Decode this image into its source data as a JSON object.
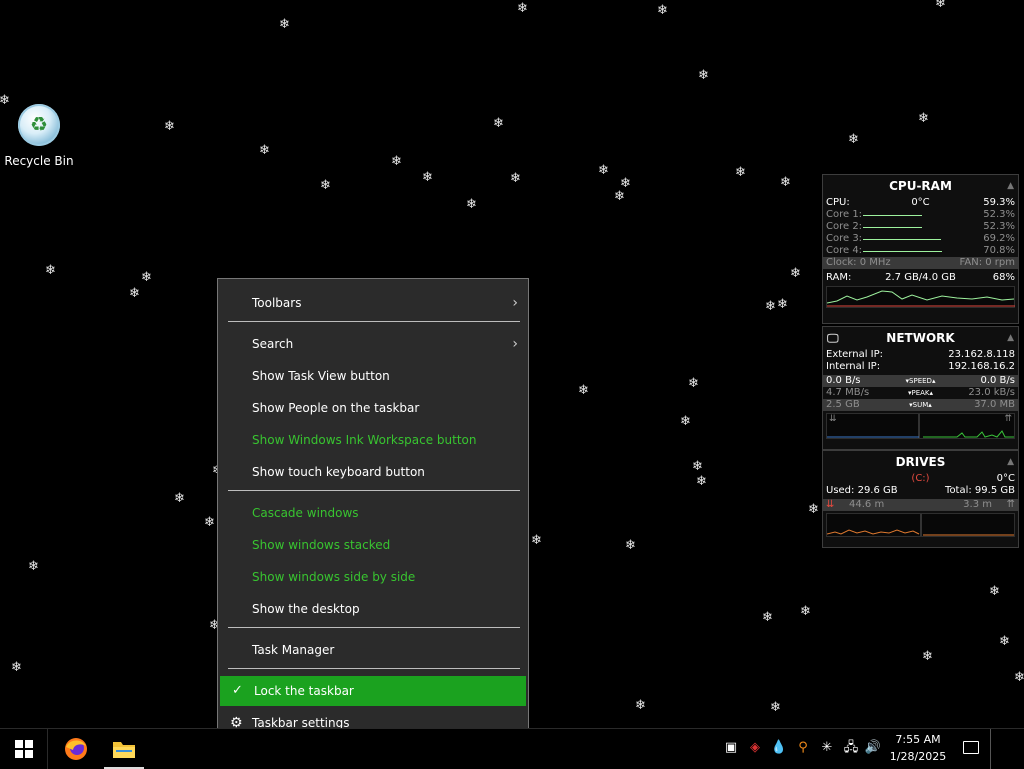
{
  "desktop": {
    "recycle_bin_label": "Recycle Bin"
  },
  "context_menu": {
    "toolbars": "Toolbars",
    "search": "Search",
    "show_task_view": "Show Task View button",
    "show_people": "Show People on the taskbar",
    "show_ink": "Show Windows Ink Workspace button",
    "show_touch_keyboard": "Show touch keyboard button",
    "cascade": "Cascade windows",
    "stacked": "Show windows stacked",
    "side_by_side": "Show windows side by side",
    "show_desktop": "Show the desktop",
    "task_manager": "Task Manager",
    "lock_taskbar": "Lock the taskbar",
    "taskbar_settings": "Taskbar settings",
    "chevron": "›",
    "check": "✓",
    "gear": "⚙",
    "highlight_color": "#1ba21f",
    "disabled_color": "#38c430"
  },
  "cpu_ram": {
    "title": "CPU-RAM",
    "cpu_label": "CPU:",
    "cpu_temp": "0°C",
    "cpu_pct": "59.3%",
    "cores": [
      {
        "label": "Core 1:",
        "value": "52.3%",
        "load": 0.523
      },
      {
        "label": "Core 2:",
        "value": "52.3%",
        "load": 0.523
      },
      {
        "label": "Core 3:",
        "value": "69.2%",
        "load": 0.692
      },
      {
        "label": "Core 4:",
        "value": "70.8%",
        "load": 0.708
      }
    ],
    "clock": "Clock: 0 MHz",
    "fan": "FAN: 0 rpm",
    "ram_label": "RAM:",
    "ram_used": "2.7 GB/4.0 GB",
    "ram_pct": "68%"
  },
  "network": {
    "title": "NETWORK",
    "external_label": "External IP:",
    "external_ip": "23.162.8.118",
    "internal_label": "Internal IP:",
    "internal_ip": "192.168.16.2",
    "speed_down": "0.0 B/s",
    "speed_label": "▾SPEED▴",
    "speed_up": "0.0 B/s",
    "peak_down": "4.7 MB/s",
    "peak_label": "▾PEAK▴",
    "peak_up": "23.0 kB/s",
    "sum_down": "2.5 GB",
    "sum_label": "▾SUM▴",
    "sum_up": "37.0 MB"
  },
  "drives": {
    "title": "DRIVES",
    "drive": "(C:)",
    "temp": "0°C",
    "used": "Used: 29.6 GB",
    "total": "Total: 99.5 GB",
    "read": "44.6 m",
    "write": "3.3 m"
  },
  "taskbar": {
    "time": "7:55 AM",
    "date": "1/28/2025"
  }
}
